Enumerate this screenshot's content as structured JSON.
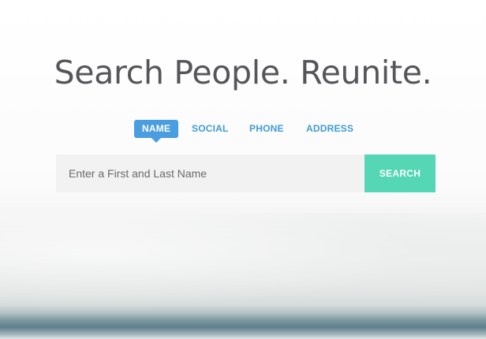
{
  "hero": {
    "headline": "Search People. Reunite."
  },
  "tabs": [
    {
      "label": "NAME",
      "active": true
    },
    {
      "label": "SOCIAL",
      "active": false
    },
    {
      "label": "PHONE",
      "active": false
    },
    {
      "label": "ADDRESS",
      "active": false
    }
  ],
  "search": {
    "placeholder": "Enter a First and Last Name",
    "value": "",
    "button_label": "SEARCH"
  },
  "colors": {
    "headline": "#555659",
    "tab_active_bg": "#4a9ee0",
    "tab_text": "#3f9bd6",
    "search_button_bg": "#55d6b5",
    "input_bg": "#f2f2f2"
  }
}
